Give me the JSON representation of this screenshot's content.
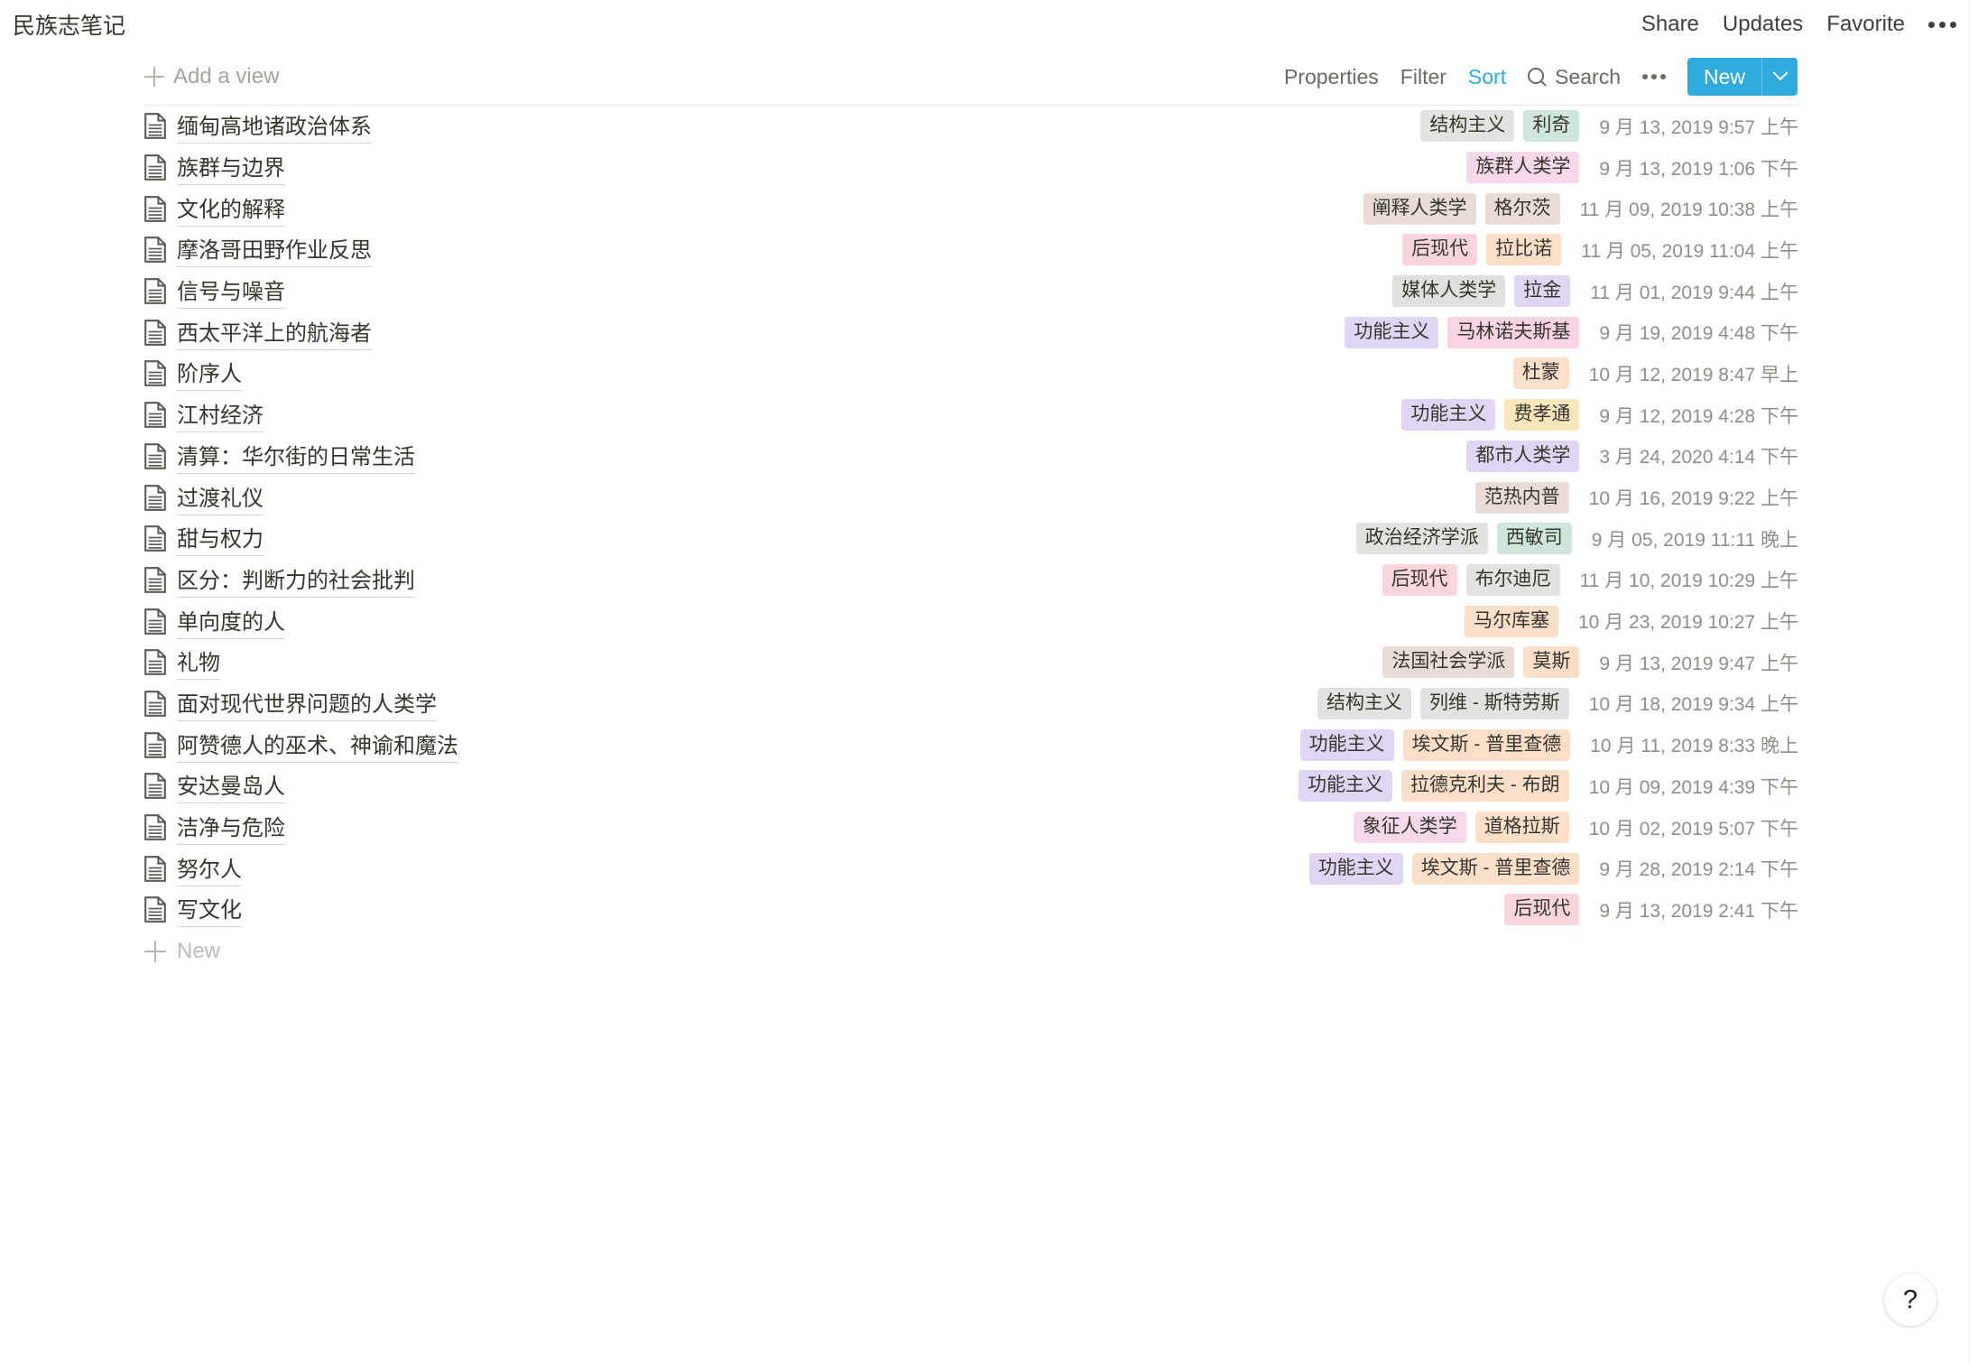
{
  "header": {
    "title": "民族志笔记",
    "links": [
      {
        "label": "Share",
        "name": "share-button"
      },
      {
        "label": "Updates",
        "name": "updates-button"
      },
      {
        "label": "Favorite",
        "name": "favorite-button"
      }
    ],
    "more_icon": "more-horizontal-icon"
  },
  "viewbar": {
    "add_view_label": "Add a view",
    "add_view_icon": "plus-icon",
    "properties_label": "Properties",
    "filter_label": "Filter",
    "sort_label": "Sort",
    "sort_active": true,
    "search_label": "Search",
    "search_icon": "search-icon",
    "more_icon": "more-horizontal-icon",
    "new_label": "New",
    "new_caret_icon": "chevron-down-icon",
    "accent_color": "#2eaadc"
  },
  "table": {
    "row_icon": "document-icon",
    "new_row_label": "New",
    "new_row_icon": "plus-icon",
    "rows": [
      {
        "title": "缅甸高地诸政治体系",
        "tags": [
          {
            "label": "结构主义",
            "color": "#e3e2e0"
          },
          {
            "label": "利奇",
            "color": "#cfe6dd"
          }
        ],
        "date": "9 月 13, 2019 9:57 上午"
      },
      {
        "title": "族群与边界",
        "tags": [
          {
            "label": "族群人类学",
            "color": "#f5d9ea"
          }
        ],
        "date": "9 月 13, 2019 1:06 下午"
      },
      {
        "title": "文化的解释",
        "tags": [
          {
            "label": "阐释人类学",
            "color": "#e9dcd4"
          },
          {
            "label": "格尔茨",
            "color": "#e9dcd4"
          }
        ],
        "date": "11 月 09, 2019 10:38 上午"
      },
      {
        "title": "摩洛哥田野作业反思",
        "tags": [
          {
            "label": "后现代",
            "color": "#fbd5dd"
          },
          {
            "label": "拉比诺",
            "color": "#fbdfc8"
          }
        ],
        "date": "11 月 05, 2019 11:04 上午"
      },
      {
        "title": "信号与噪音",
        "tags": [
          {
            "label": "媒体人类学",
            "color": "#e0e0de"
          },
          {
            "label": "拉金",
            "color": "#e0d5f2"
          }
        ],
        "date": "11 月 01, 2019 9:44 上午"
      },
      {
        "title": "西太平洋上的航海者",
        "tags": [
          {
            "label": "功能主义",
            "color": "#e0d5f2"
          },
          {
            "label": "马林诺夫斯基",
            "color": "#f9d3e4"
          }
        ],
        "date": "9 月 19, 2019 4:48 下午"
      },
      {
        "title": "阶序人",
        "tags": [
          {
            "label": "杜蒙",
            "color": "#fbdfc8"
          }
        ],
        "date": "10 月 12, 2019 8:47 早上"
      },
      {
        "title": "江村经济",
        "tags": [
          {
            "label": "功能主义",
            "color": "#e0d5f2"
          },
          {
            "label": "费孝通",
            "color": "#f8e7bd"
          }
        ],
        "date": "9 月 12, 2019 4:28 下午"
      },
      {
        "title": "清算：华尔街的日常生活",
        "tags": [
          {
            "label": "都市人类学",
            "color": "#e0d5f2"
          }
        ],
        "date": "3 月 24, 2020 4:14 下午"
      },
      {
        "title": "过渡礼仪",
        "tags": [
          {
            "label": "范热内普",
            "color": "#e9dcd4"
          }
        ],
        "date": "10 月 16, 2019 9:22 上午"
      },
      {
        "title": "甜与权力",
        "tags": [
          {
            "label": "政治经济学派",
            "color": "#e3e2e0"
          },
          {
            "label": "西敏司",
            "color": "#cfe6dd"
          }
        ],
        "date": "9 月 05, 2019 11:11 晚上"
      },
      {
        "title": "区分：判断力的社会批判",
        "tags": [
          {
            "label": "后现代",
            "color": "#fbd5dd"
          },
          {
            "label": "布尔迪厄",
            "color": "#e3e2e0"
          }
        ],
        "date": "11 月 10, 2019 10:29 上午"
      },
      {
        "title": "单向度的人",
        "tags": [
          {
            "label": "马尔库塞",
            "color": "#fbdfc8"
          }
        ],
        "date": "10 月 23, 2019 10:27 上午"
      },
      {
        "title": "礼物",
        "tags": [
          {
            "label": "法国社会学派",
            "color": "#e9dcd4"
          },
          {
            "label": "莫斯",
            "color": "#fbdfc8"
          }
        ],
        "date": "9 月 13, 2019 9:47 上午"
      },
      {
        "title": "面对现代世界问题的人类学",
        "tags": [
          {
            "label": "结构主义",
            "color": "#e3e2e0"
          },
          {
            "label": "列维 - 斯特劳斯",
            "color": "#e3e2e0"
          }
        ],
        "date": "10 月 18, 2019 9:34 上午"
      },
      {
        "title": "阿赞德人的巫术、神谕和魔法",
        "tags": [
          {
            "label": "功能主义",
            "color": "#e0d5f2"
          },
          {
            "label": "埃文斯 - 普里查德",
            "color": "#fbdfc8"
          }
        ],
        "date": "10 月 11, 2019 8:33 晚上"
      },
      {
        "title": "安达曼岛人",
        "tags": [
          {
            "label": "功能主义",
            "color": "#e0d5f2"
          },
          {
            "label": "拉德克利夫 - 布朗",
            "color": "#fbdfc8"
          }
        ],
        "date": "10 月 09, 2019 4:39 下午"
      },
      {
        "title": "洁净与危险",
        "tags": [
          {
            "label": "象征人类学",
            "color": "#f5d9ea"
          },
          {
            "label": "道格拉斯",
            "color": "#fbdfc8"
          }
        ],
        "date": "10 月 02, 2019 5:07 下午"
      },
      {
        "title": "努尔人",
        "tags": [
          {
            "label": "功能主义",
            "color": "#e0d5f2"
          },
          {
            "label": "埃文斯 - 普里查德",
            "color": "#fbdfc8"
          }
        ],
        "date": "9 月 28, 2019 2:14 下午"
      },
      {
        "title": "写文化",
        "tags": [
          {
            "label": "后现代",
            "color": "#fbd5dd"
          }
        ],
        "date": "9 月 13, 2019 2:41 下午"
      }
    ]
  },
  "help": {
    "label": "?",
    "icon": "question-mark-icon"
  }
}
